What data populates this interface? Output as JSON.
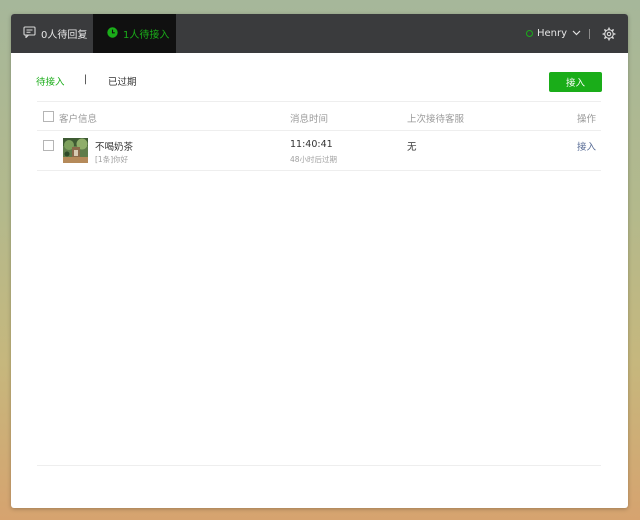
{
  "topbar": {
    "tab_pending_reply": "0人待回复",
    "tab_pending_accept": "1人待接入",
    "user_name": "Henry"
  },
  "subtabs": {
    "pending": "待接入",
    "separator": "|",
    "expired": "已过期"
  },
  "toolbar": {
    "accept_label": "接入"
  },
  "table": {
    "columns": [
      "客户信息",
      "消息时间",
      "上次接待客服",
      "操作"
    ],
    "rows": [
      {
        "name": "不喝奶茶",
        "preview": "[1条]你好",
        "time": "11:40:41",
        "expire_note": "48小时后过期",
        "last_agent": "无",
        "action": "接入"
      }
    ]
  },
  "colors": {
    "accent": "#1aad19",
    "topbar": "#3a3b3d",
    "active_tab": "#101010",
    "link": "#576b95"
  },
  "icons": {
    "pending_reply": "chat-bubble-icon",
    "pending_accept": "clock-icon",
    "status": "online-status-icon",
    "dropdown": "chevron-down-icon",
    "settings": "gear-icon"
  }
}
